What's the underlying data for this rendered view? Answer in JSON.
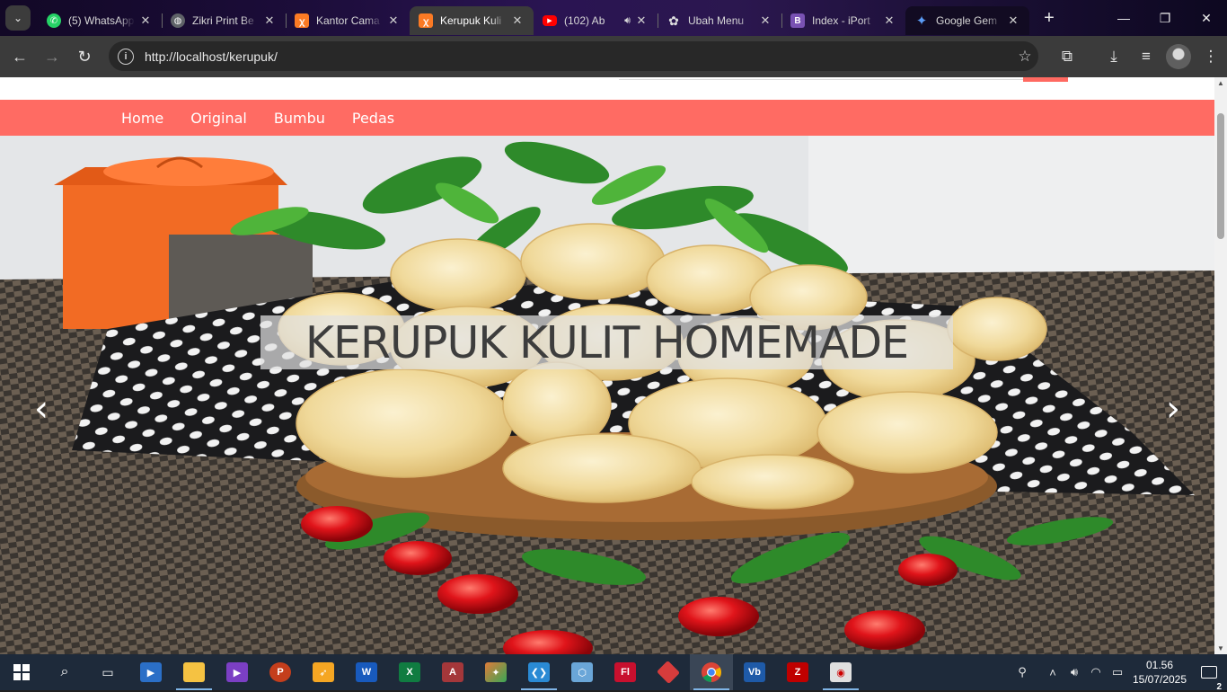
{
  "browser": {
    "tabs": [
      {
        "title": "(5) WhatsApp",
        "icon": "whatsapp-icon",
        "color": "#25d366"
      },
      {
        "title": "Zikri Print Be",
        "icon": "globe-icon",
        "color": "#9aa0a6"
      },
      {
        "title": "Kantor Cama",
        "icon": "xampp-icon",
        "color": "#fb7a24"
      },
      {
        "title": "Kerupuk Kuli",
        "icon": "xampp-icon",
        "color": "#fb7a24",
        "active": true
      },
      {
        "title": "(102) Ab",
        "icon": "youtube-icon",
        "color": "#ff0000"
      },
      {
        "title": "Ubah Menu",
        "icon": "chatgpt-icon",
        "color": "#cfcfcf"
      },
      {
        "title": "Index - iPort",
        "icon": "bootstrap-icon",
        "color": "#7952b3"
      },
      {
        "title": "Google Gem",
        "icon": "gemini-icon",
        "color": "#4f8df5"
      }
    ],
    "url": "http://localhost/kerupuk/"
  },
  "site": {
    "nav": [
      "Home",
      "Original",
      "Bumbu",
      "Pedas"
    ],
    "accent": "#ff6b63",
    "hero_caption": "KERUPUK KULIT HOMEMADE",
    "prev_arrow": "‹",
    "next_arrow": "›"
  },
  "taskbar": {
    "apps": [
      {
        "name": "file-explorer-search",
        "icon": "search-icon"
      },
      {
        "name": "task-view",
        "icon": "task-view-icon"
      },
      {
        "name": "media-player",
        "icon": "media-player-icon",
        "color": "#f28b2b"
      },
      {
        "name": "file-explorer",
        "icon": "folder-icon",
        "color": "#f5c242"
      },
      {
        "name": "visual-studio",
        "icon": "visual-studio-icon",
        "color": "#7b3fc4"
      },
      {
        "name": "powerpoint",
        "icon": "powerpoint-icon",
        "color": "#c43e1c",
        "letter": "P"
      },
      {
        "name": "app-bird",
        "icon": "bird-icon",
        "color": "#f5a623"
      },
      {
        "name": "word",
        "icon": "word-icon",
        "color": "#185abd",
        "letter": "W"
      },
      {
        "name": "excel",
        "icon": "excel-icon",
        "color": "#107c41",
        "letter": "X"
      },
      {
        "name": "access",
        "icon": "access-icon",
        "color": "#a4373a",
        "letter": "A"
      },
      {
        "name": "app-pattern",
        "icon": "pattern-icon",
        "color": "#e07b39"
      },
      {
        "name": "vscode",
        "icon": "vscode-icon",
        "color": "#2a8ad4"
      },
      {
        "name": "virtualbox",
        "icon": "cube-icon",
        "color": "#6aa6d8"
      },
      {
        "name": "app-fl",
        "icon": "fl-icon",
        "color": "#c8102e",
        "letter": "Fl"
      },
      {
        "name": "app-diamond",
        "icon": "diamond-icon",
        "color": "#d73c3c"
      },
      {
        "name": "chrome",
        "icon": "chrome-icon",
        "color": "#4285f4",
        "active": true
      },
      {
        "name": "vb",
        "icon": "vb-icon",
        "color": "#1e5aa8",
        "letter": "Vb"
      },
      {
        "name": "filezilla",
        "icon": "filezilla-icon",
        "color": "#bf0000",
        "letter": "Z"
      },
      {
        "name": "app-record",
        "icon": "record-icon",
        "color": "#e0e0e0"
      }
    ],
    "time": "01.56",
    "date": "15/07/2025",
    "notifications": "2"
  }
}
